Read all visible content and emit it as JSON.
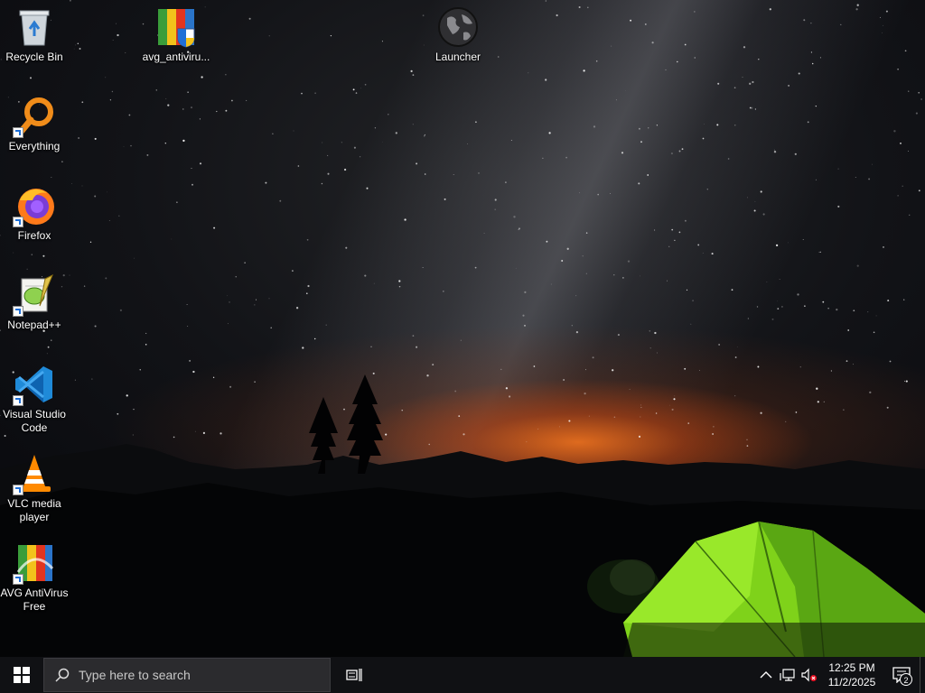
{
  "desktop": {
    "icons": [
      {
        "id": "recycle-bin",
        "label": "Recycle Bin",
        "icon": "recycle-bin-icon"
      },
      {
        "id": "everything",
        "label": "Everything",
        "icon": "magnifier-icon"
      },
      {
        "id": "firefox",
        "label": "Firefox",
        "icon": "firefox-icon"
      },
      {
        "id": "notepadpp",
        "label": "Notepad++",
        "icon": "notepadpp-icon"
      },
      {
        "id": "vscode",
        "label": "Visual Studio Code",
        "icon": "vscode-icon"
      },
      {
        "id": "vlc",
        "label": "VLC media player",
        "icon": "vlc-cone-icon"
      },
      {
        "id": "avg-free",
        "label": "AVG AntiVirus Free",
        "icon": "avg-icon"
      },
      {
        "id": "avg-installer",
        "label": "avg_antiviru...",
        "icon": "avg-installer-icon"
      },
      {
        "id": "launcher",
        "label": "Launcher",
        "icon": "globe-icon"
      }
    ]
  },
  "taskbar": {
    "search_placeholder": "Type here to search",
    "clock_time": "12:25 PM",
    "clock_date": "11/2/2025",
    "notification_count": "2"
  }
}
